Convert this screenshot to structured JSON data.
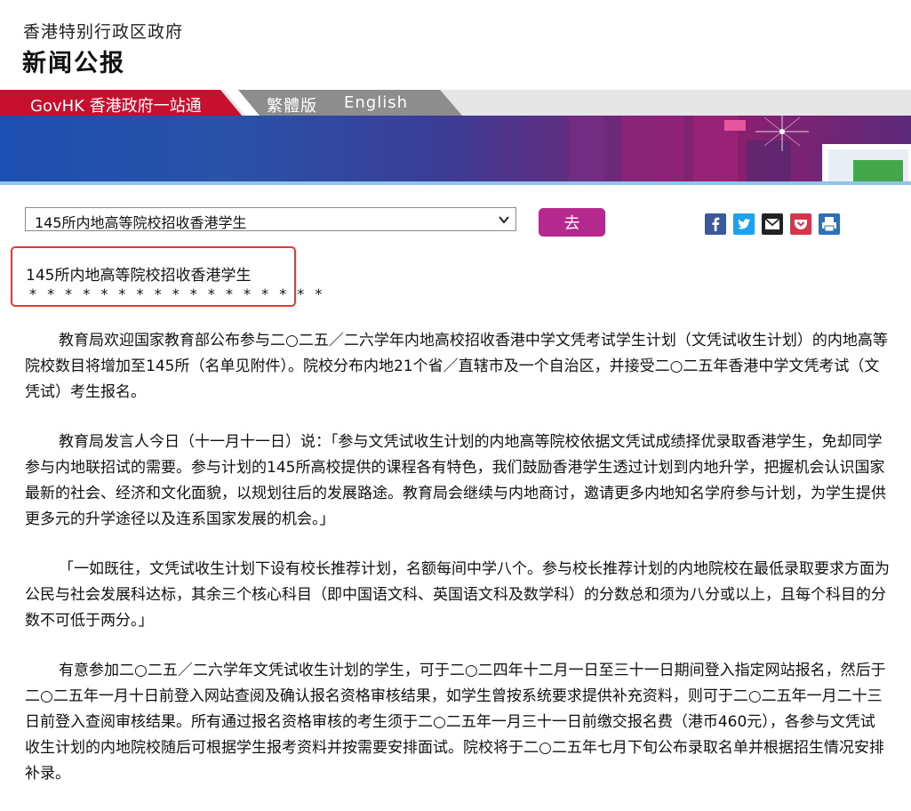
{
  "header": {
    "gov_name": "香港特别行政区政府",
    "title": "新闻公报"
  },
  "nav": {
    "govhk": "GovHK 香港政府一站通",
    "traditional": "繁體版",
    "english": "English"
  },
  "selector": {
    "selected": "145所内地高等院校招收香港学生",
    "go_label": "去"
  },
  "share_icons": [
    "facebook-icon",
    "twitter-icon",
    "email-icon",
    "pocket-icon",
    "print-icon"
  ],
  "colors": {
    "accent": "#b5298e",
    "govhk_red": "#c8102e",
    "highlight_border": "#e53935"
  },
  "article": {
    "headline": "145所内地高等院校招收香港学生",
    "divider": "* * * * * * * * * * * * * * * * *",
    "paragraphs": [
      "教育局欢迎国家教育部公布参与二○二五／二六学年内地高校招收香港中学文凭考试学生计划（文凭试收生计划）的内地高等院校数目将增加至145所（名单见附件）。院校分布内地21个省／直辖市及一个自治区，并接受二○二五年香港中学文凭考试（文凭试）考生报名。",
      "教育局发言人今日（十一月十一日）说：「参与文凭试收生计划的内地高等院校依据文凭试成绩择优录取香港学生，免却同学参与内地联招试的需要。参与计划的145所高校提供的课程各有特色，我们鼓励香港学生透过计划到内地升学，把握机会认识国家最新的社会、经济和文化面貌，以规划往后的发展路途。教育局会继续与内地商讨，邀请更多内地知名学府参与计划，为学生提供更多元的升学途径以及连系国家发展的机会。」",
      "「一如既往，文凭试收生计划下设有校长推荐计划，名额每间中学八个。参与校长推荐计划的内地院校在最低录取要求方面为公民与社会发展科达标，其余三个核心科目（即中国语文科、英国语文科及数学科）的分数总和须为八分或以上，且每个科目的分数不可低于两分。」",
      "有意参加二○二五／二六学年文凭试收生计划的学生，可于二○二四年十二月一日至三十一日期间登入指定网站报名，然后于二○二五年一月十日前登入网站查阅及确认报名资格审核结果，如学生曾按系统要求提供补充资料，则可于二○二五年一月二十三日前登入查阅审核结果。所有通过报名资格审核的考生须于二○二五年一月三十一日前缴交报名费（港币460元），各参与文凭试收生计划的内地院校随后可根据学生报考资料并按需要安排面试。院校将于二○二五年七月下旬公布录取名单并根据招生情况安排补录。"
    ]
  }
}
